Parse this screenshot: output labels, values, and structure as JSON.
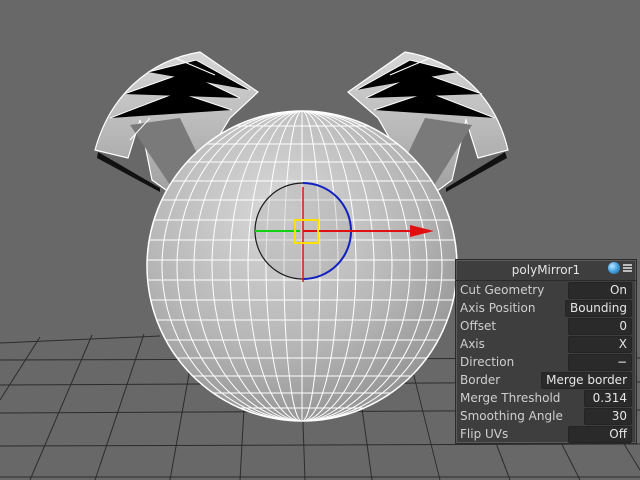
{
  "panel": {
    "title": "polyMirror1",
    "rows": [
      {
        "label": "Cut Geometry",
        "value": "On"
      },
      {
        "label": "Axis Position",
        "value": "Bounding"
      },
      {
        "label": "Offset",
        "value": "0"
      },
      {
        "label": "Axis",
        "value": "X"
      },
      {
        "label": "Direction",
        "value": "−"
      },
      {
        "label": "Border",
        "value": "Merge border"
      },
      {
        "label": "Merge Threshold",
        "value": "0.314"
      },
      {
        "label": "Smoothing Angle",
        "value": "30"
      },
      {
        "label": "Flip UVs",
        "value": "Off"
      }
    ]
  },
  "icons": [
    "polymirror-node-icon",
    "panel-menu-icon"
  ],
  "colors": {
    "background": "#686868",
    "grid": "#2a2a2a",
    "wireframe": "#ffffff",
    "x_axis": "#e01010",
    "y_axis": "#12d012",
    "rotate_ring": "#1020c0",
    "pivot": "#ffe000",
    "panel_bg": "#3e3e3e"
  }
}
